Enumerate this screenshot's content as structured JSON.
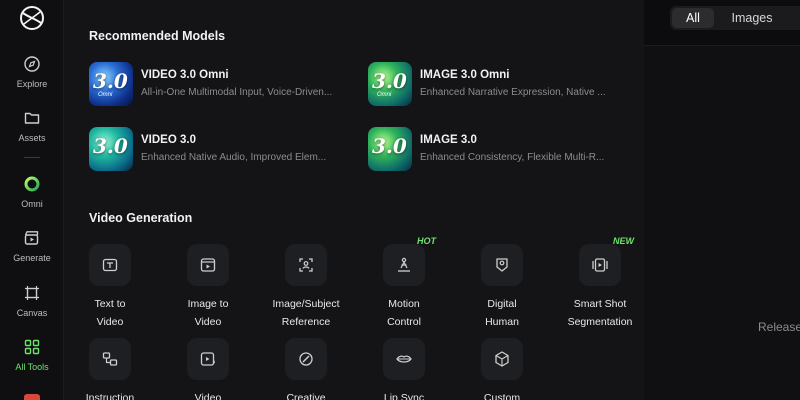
{
  "sidebar": {
    "items": [
      {
        "label": "Explore",
        "icon": "compass-icon"
      },
      {
        "label": "Assets",
        "icon": "folder-icon"
      },
      {
        "label": "Omni",
        "icon": "omni-ring-icon"
      },
      {
        "label": "Generate",
        "icon": "clapper-icon"
      },
      {
        "label": "Canvas",
        "icon": "canvas-frame-icon"
      },
      {
        "label": "All Tools",
        "icon": "grid-icon"
      }
    ],
    "active": "All Tools",
    "accent": "#6ee26e"
  },
  "recommended": {
    "title": "Recommended Models",
    "models": [
      {
        "name": "VIDEO 3.0 Omni",
        "badge_num": "3.0",
        "badge_tag": "Omni",
        "desc": "All-in-One Multimodal Input, Voice-Driven..."
      },
      {
        "name": "IMAGE 3.0 Omni",
        "badge_num": "3.0",
        "badge_tag": "Omni",
        "desc": "Enhanced Narrative Expression, Native ..."
      },
      {
        "name": "VIDEO 3.0",
        "badge_num": "3.0",
        "badge_tag": "",
        "desc": "Enhanced Native Audio, Improved Elem..."
      },
      {
        "name": "IMAGE 3.0",
        "badge_num": "3.0",
        "badge_tag": "",
        "desc": "Enhanced Consistency, Flexible Multi-R..."
      }
    ]
  },
  "video_generation": {
    "title": "Video Generation",
    "tools": [
      {
        "line1": "Text to",
        "line2": "Video",
        "badge": "",
        "icon": "text-to-video-icon"
      },
      {
        "line1": "Image to",
        "line2": "Video",
        "badge": "",
        "icon": "image-to-video-icon"
      },
      {
        "line1": "Image/Subject",
        "line2": "Reference",
        "badge": "",
        "icon": "subject-reference-icon"
      },
      {
        "line1": "Motion",
        "line2": "Control",
        "badge": "HOT",
        "icon": "motion-control-icon"
      },
      {
        "line1": "Digital",
        "line2": "Human",
        "badge": "",
        "icon": "digital-human-icon"
      },
      {
        "line1": "Smart Shot",
        "line2": "Segmentation",
        "badge": "NEW",
        "icon": "shot-segmentation-icon"
      },
      {
        "line1": "Instruction",
        "line2": "",
        "badge": "",
        "icon": "instruction-icon"
      },
      {
        "line1": "Video",
        "line2": "",
        "badge": "",
        "icon": "video-sparkle-icon"
      },
      {
        "line1": "Creative",
        "line2": "",
        "badge": "",
        "icon": "creative-brush-icon"
      },
      {
        "line1": "Lip Sync",
        "line2": "",
        "badge": "",
        "icon": "lips-icon"
      },
      {
        "line1": "Custom",
        "line2": "",
        "badge": "",
        "icon": "custom-cube-icon"
      }
    ],
    "badge_color": "#6ee26e"
  },
  "right_panel": {
    "tabs": [
      {
        "label": "All"
      },
      {
        "label": "Images"
      }
    ],
    "active_tab": "All",
    "release_text": "Release"
  }
}
